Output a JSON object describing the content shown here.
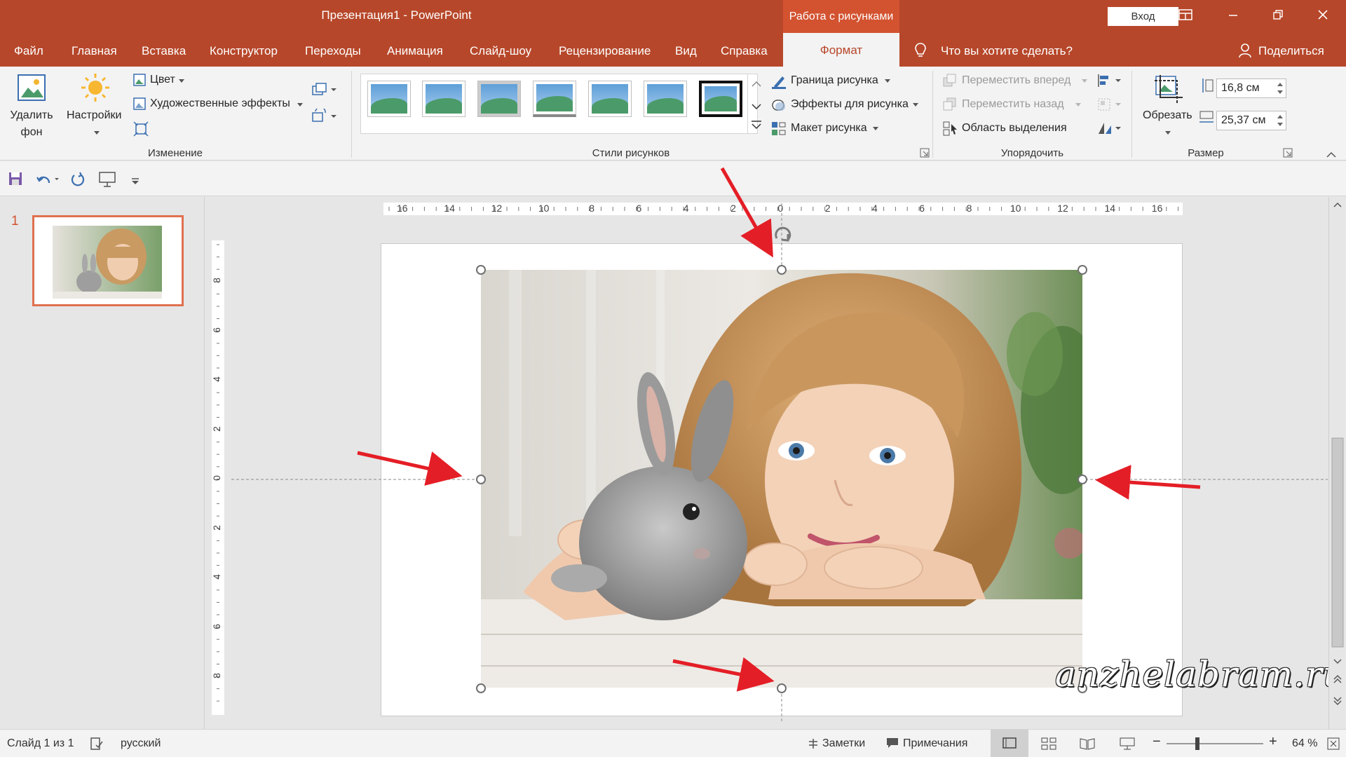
{
  "window": {
    "title": "Презентация1  -  PowerPoint",
    "context_tab_group": "Работа с рисунками",
    "signin_label": "Вход"
  },
  "tabs": [
    {
      "label": "Файл"
    },
    {
      "label": "Главная"
    },
    {
      "label": "Вставка"
    },
    {
      "label": "Конструктор"
    },
    {
      "label": "Переходы"
    },
    {
      "label": "Анимация"
    },
    {
      "label": "Слайд-шоу"
    },
    {
      "label": "Рецензирование"
    },
    {
      "label": "Вид"
    },
    {
      "label": "Справка"
    },
    {
      "label": "Формат",
      "active": true
    }
  ],
  "tell_me": "Что вы хотите сделать?",
  "share_label": "Поделиться",
  "ribbon": {
    "adjust": {
      "remove_bg": "Удалить фон",
      "remove_bg_line1": "Удалить",
      "remove_bg_line2": "фон",
      "corrections": "Настройки",
      "color": "Цвет",
      "artistic": "Художественные эффекты",
      "group_label": "Изменение"
    },
    "styles": {
      "group_label": "Стили рисунков",
      "border": "Граница рисунка",
      "effects": "Эффекты для рисунка",
      "layout": "Макет рисунка"
    },
    "arrange": {
      "group_label": "Упорядочить",
      "forward": "Переместить вперед",
      "backward": "Переместить назад",
      "selection_pane": "Область выделения"
    },
    "size": {
      "group_label": "Размер",
      "crop": "Обрезать",
      "height": "16,8 см",
      "width": "25,37 см"
    }
  },
  "slides_pane": {
    "slide_number": "1"
  },
  "rulers": {
    "horizontal": [
      "16",
      "14",
      "12",
      "10",
      "8",
      "6",
      "4",
      "2",
      "0",
      "2",
      "4",
      "6",
      "8",
      "10",
      "12",
      "14",
      "16"
    ],
    "vertical": [
      "8",
      "6",
      "4",
      "2",
      "0",
      "2",
      "4",
      "6",
      "8"
    ]
  },
  "status": {
    "slide_info": "Слайд 1 из 1",
    "language": "русский",
    "notes": "Заметки",
    "comments": "Примечания",
    "zoom": "64 %"
  },
  "watermark": "anzhelabram.ru",
  "colors": {
    "accent": "#b7472a",
    "accent_light": "#d35230",
    "arrow": "#e41e26"
  }
}
